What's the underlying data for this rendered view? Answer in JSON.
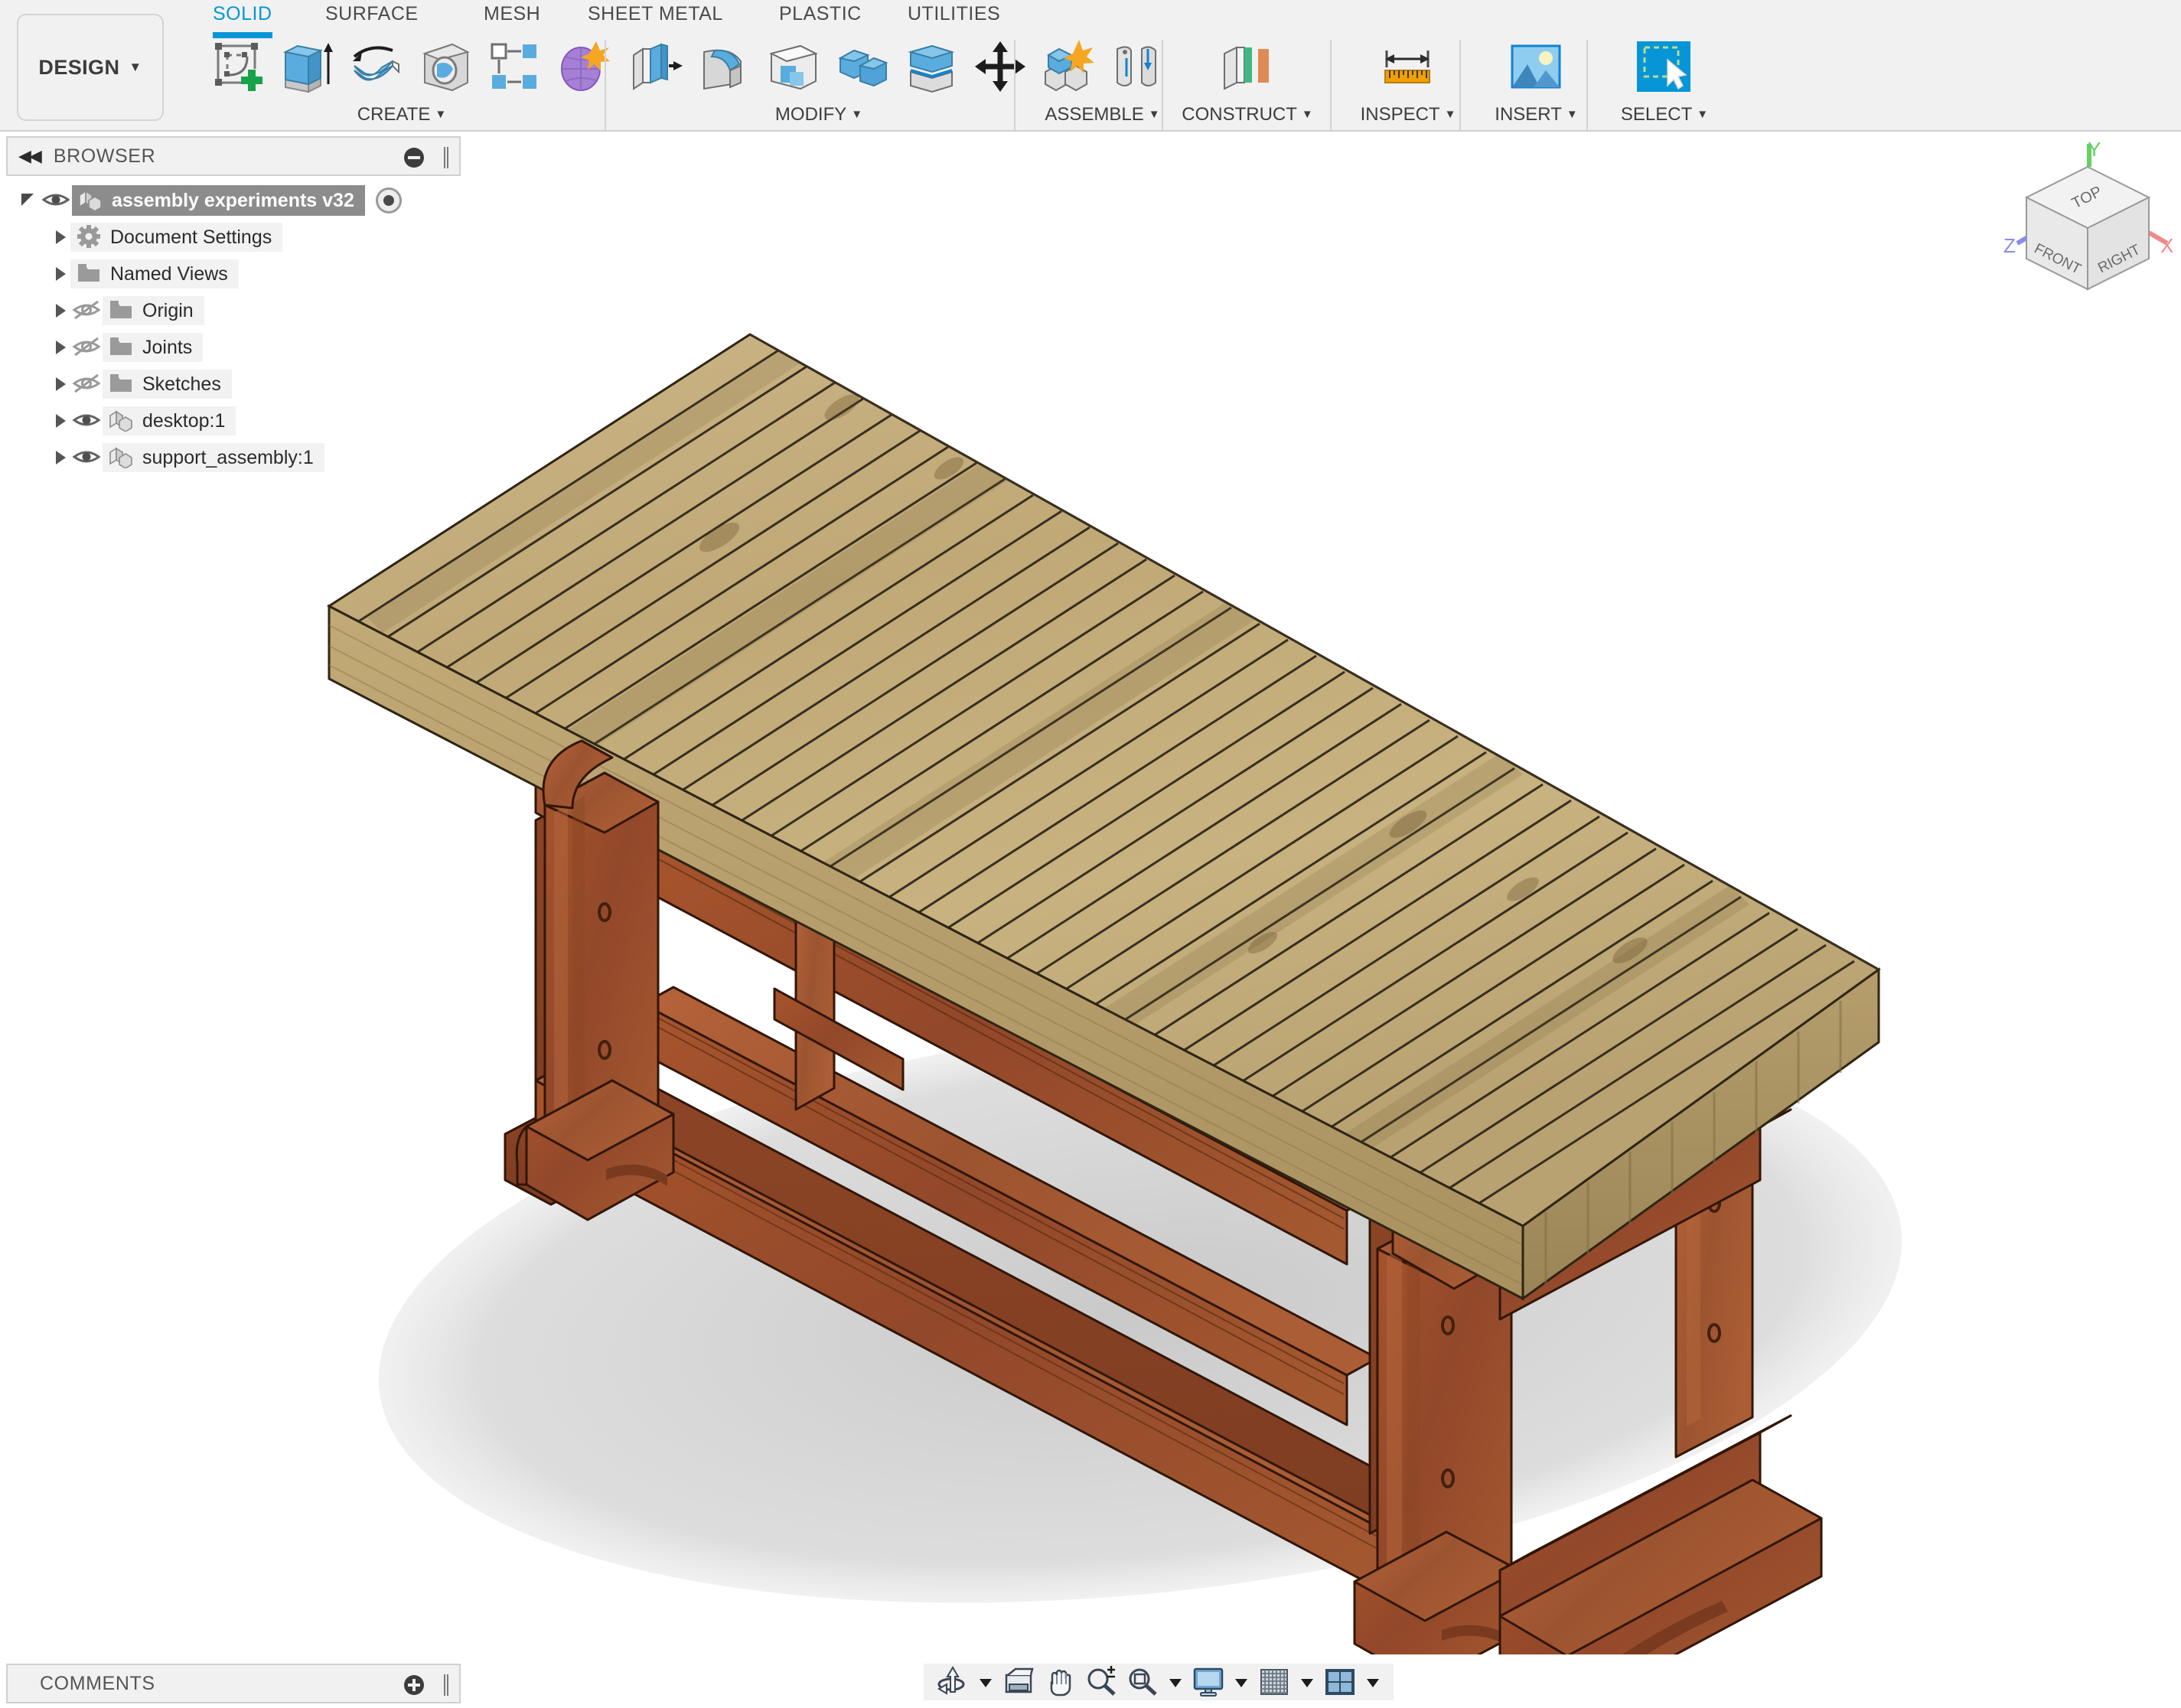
{
  "app": {
    "workspace_button": "DESIGN",
    "tabs": [
      {
        "label": "SOLID",
        "active": true
      },
      {
        "label": "SURFACE",
        "active": false
      },
      {
        "label": "MESH",
        "active": false
      },
      {
        "label": "SHEET METAL",
        "active": false
      },
      {
        "label": "PLASTIC",
        "active": false
      },
      {
        "label": "UTILITIES",
        "active": false
      }
    ],
    "groups": [
      {
        "label": "CREATE",
        "icons": [
          "create-sketch-icon",
          "extrude-icon",
          "revolve-icon",
          "hole-icon",
          "pattern-icon",
          "form-icon"
        ]
      },
      {
        "label": "MODIFY",
        "icons": [
          "press-pull-icon",
          "fillet-icon",
          "shell-icon",
          "combine-icon",
          "offset-face-icon",
          "move-copy-icon"
        ]
      },
      {
        "label": "ASSEMBLE",
        "icons": [
          "new-component-icon",
          "joint-icon"
        ]
      },
      {
        "label": "CONSTRUCT",
        "icons": [
          "offset-plane-icon"
        ]
      },
      {
        "label": "INSPECT",
        "icons": [
          "measure-icon"
        ]
      },
      {
        "label": "INSERT",
        "icons": [
          "insert-image-icon"
        ]
      },
      {
        "label": "SELECT",
        "icons": [
          "select-window-icon"
        ]
      }
    ],
    "accent_color": "#0696d7",
    "ribbon_bg": "#f1f1f1"
  },
  "browser": {
    "title": "BROWSER",
    "collapse_icon": "collapse-left-icon",
    "minimize_icon": "minimize-icon",
    "items": [
      {
        "label": "assembly experiments v32",
        "indent": 0,
        "twisty": "expanded",
        "eye": "visible",
        "icon": "component-icon",
        "selected": true,
        "radio": true
      },
      {
        "label": "Document Settings",
        "indent": 1,
        "twisty": "collapsed",
        "eye": "none",
        "icon": "gear-icon",
        "selected": false,
        "radio": false
      },
      {
        "label": "Named Views",
        "indent": 1,
        "twisty": "collapsed",
        "eye": "none",
        "icon": "folder-icon",
        "selected": false,
        "radio": false
      },
      {
        "label": "Origin",
        "indent": 1,
        "twisty": "collapsed",
        "eye": "hidden",
        "icon": "folder-icon",
        "selected": false,
        "radio": false
      },
      {
        "label": "Joints",
        "indent": 1,
        "twisty": "collapsed",
        "eye": "hidden",
        "icon": "folder-icon",
        "selected": false,
        "radio": false
      },
      {
        "label": "Sketches",
        "indent": 1,
        "twisty": "collapsed",
        "eye": "hidden",
        "icon": "folder-icon",
        "selected": false,
        "radio": false
      },
      {
        "label": "desktop:1",
        "indent": 1,
        "twisty": "collapsed",
        "eye": "visible",
        "icon": "component-icon",
        "selected": false,
        "radio": false
      },
      {
        "label": "support_assembly:1",
        "indent": 1,
        "twisty": "collapsed",
        "eye": "visible",
        "icon": "component-icon",
        "selected": false,
        "radio": false
      }
    ]
  },
  "viewcube": {
    "top_face": "TOP",
    "front_face": "FRONT",
    "right_face": "RIGHT",
    "axis_x": "X",
    "axis_y": "Y",
    "axis_z": "Z",
    "axis_x_color": "#f08a8a",
    "axis_y_color": "#64d264",
    "axis_z_color": "#8a8af0"
  },
  "model": {
    "description": "Wooden workbench / trestle table assembly",
    "tabletop_color": "#bda876",
    "tabletop_slat_count": 40,
    "base_color": "#a0522d",
    "shadow_color": "#d9d9d9"
  },
  "comments": {
    "title": "COMMENTS",
    "add_icon": "add-comment-icon"
  },
  "navbar": {
    "items": [
      {
        "name": "orbit-icon",
        "caret": true
      },
      {
        "name": "look-at-icon",
        "caret": false
      },
      {
        "name": "pan-hand-icon",
        "caret": false
      },
      {
        "name": "zoom-icon",
        "caret": false
      },
      {
        "name": "fit-icon",
        "caret": true
      },
      {
        "name": "display-settings-icon",
        "caret": true
      },
      {
        "name": "grid-snap-icon",
        "caret": true
      },
      {
        "name": "viewports-icon",
        "caret": true
      }
    ]
  }
}
